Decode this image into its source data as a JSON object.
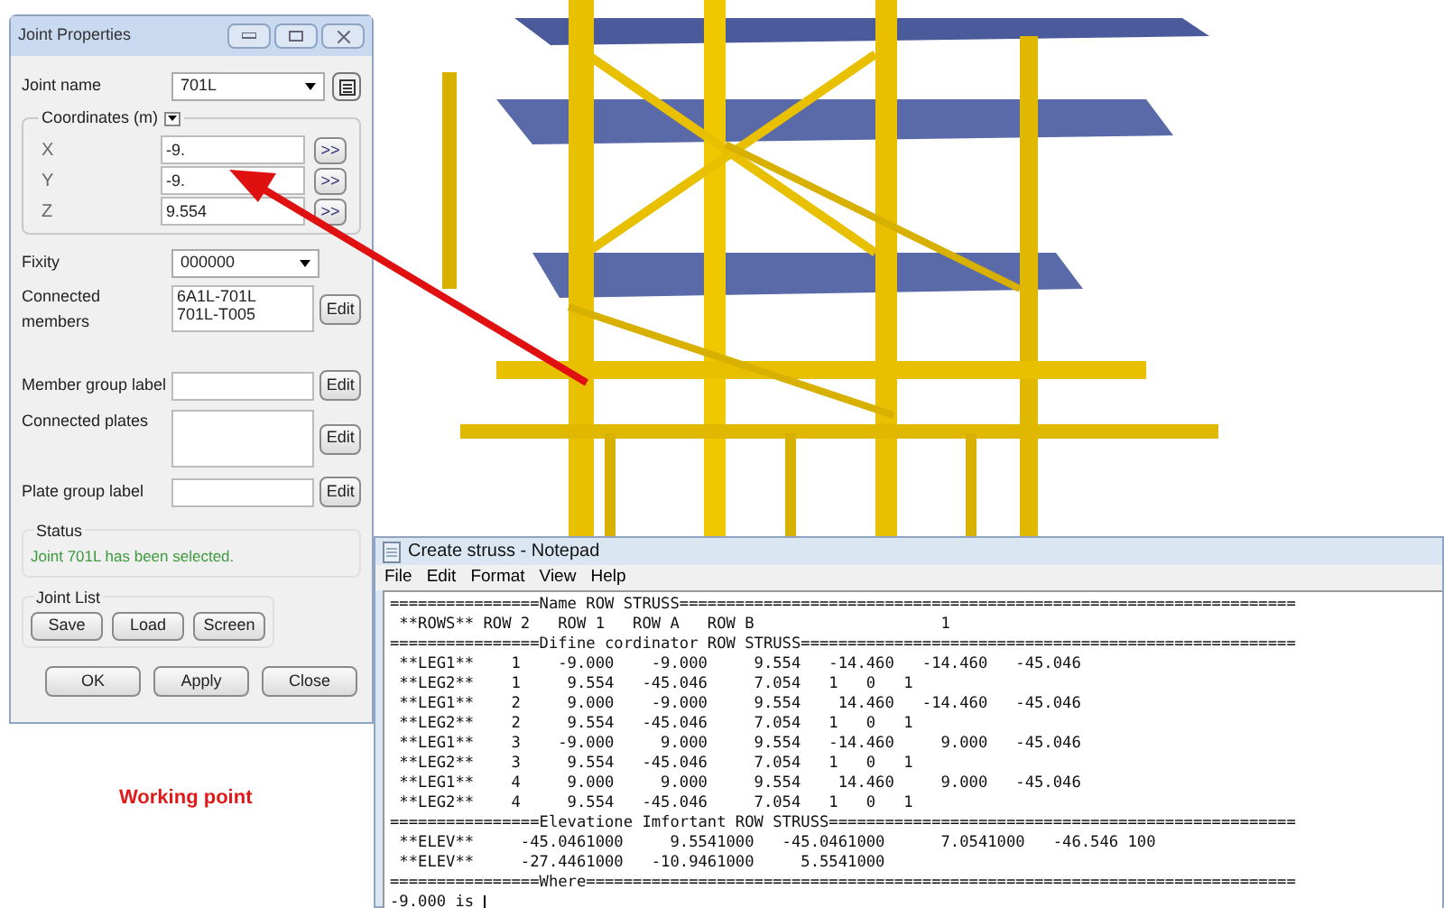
{
  "dialog": {
    "title": "Joint Properties",
    "joint_name": {
      "label": "Joint name",
      "value": "701L"
    },
    "coordinates": {
      "label": "Coordinates (m)",
      "fields": [
        {
          "label": "X",
          "value": "-9.",
          "button": ">>"
        },
        {
          "label": "Y",
          "value": "-9.",
          "button": ">>"
        },
        {
          "label": "Z",
          "value": "9.554",
          "button": ">>"
        }
      ]
    },
    "fixity": {
      "label": "Fixity",
      "value": "000000"
    },
    "connected_members": {
      "label": "Connected members",
      "values": [
        "6A1L-701L",
        "701L-T005"
      ],
      "button": "Edit"
    },
    "member_group_label": {
      "label": "Member group label",
      "button": "Edit"
    },
    "connected_plates": {
      "label": "Connected plates",
      "button": "Edit"
    },
    "plate_group_label": {
      "label": "Plate group label",
      "button": "Edit"
    },
    "status": {
      "label": "Status",
      "message": "Joint 701L has been selected."
    },
    "joint_list": {
      "label": "Joint List",
      "buttons": [
        "Save",
        "Load",
        "Screen"
      ]
    },
    "buttons": [
      "OK",
      "Apply",
      "Close"
    ]
  },
  "caption": "Working point",
  "notepad": {
    "title": "Create struss - Notepad",
    "menu": [
      "File",
      "Edit",
      "Format",
      "View",
      "Help"
    ],
    "lines": [
      "================Name ROW STRUSS==================================================================",
      " **ROWS** ROW 2   ROW 1   ROW A   ROW B                    1",
      "================Difine cordinator ROW STRUSS=====================================================",
      " **LEG1**    1    -9.000    -9.000     9.554   -14.460   -14.460   -45.046",
      " **LEG2**    1     9.554   -45.046     7.054   1   0   1",
      " **LEG1**    2     9.000    -9.000     9.554    14.460   -14.460   -45.046",
      " **LEG2**    2     9.554   -45.046     7.054   1   0   1",
      " **LEG1**    3    -9.000     9.000     9.554   -14.460     9.000   -45.046",
      " **LEG2**    3     9.554   -45.046     7.054   1   0   1",
      " **LEG1**    4     9.000     9.000     9.554    14.460     9.000   -45.046",
      " **LEG2**    4     9.554   -45.046     7.054   1   0   1",
      "================Elevatione Imfortant ROW STRUSS==================================================",
      " **ELEV**     -45.0461000     9.5541000   -45.0461000      7.0541000   -46.546 100",
      " **ELEV**     -27.4461000   -10.9461000     5.5541000",
      "================Where============================================================================",
      "-9.000 is "
    ]
  }
}
